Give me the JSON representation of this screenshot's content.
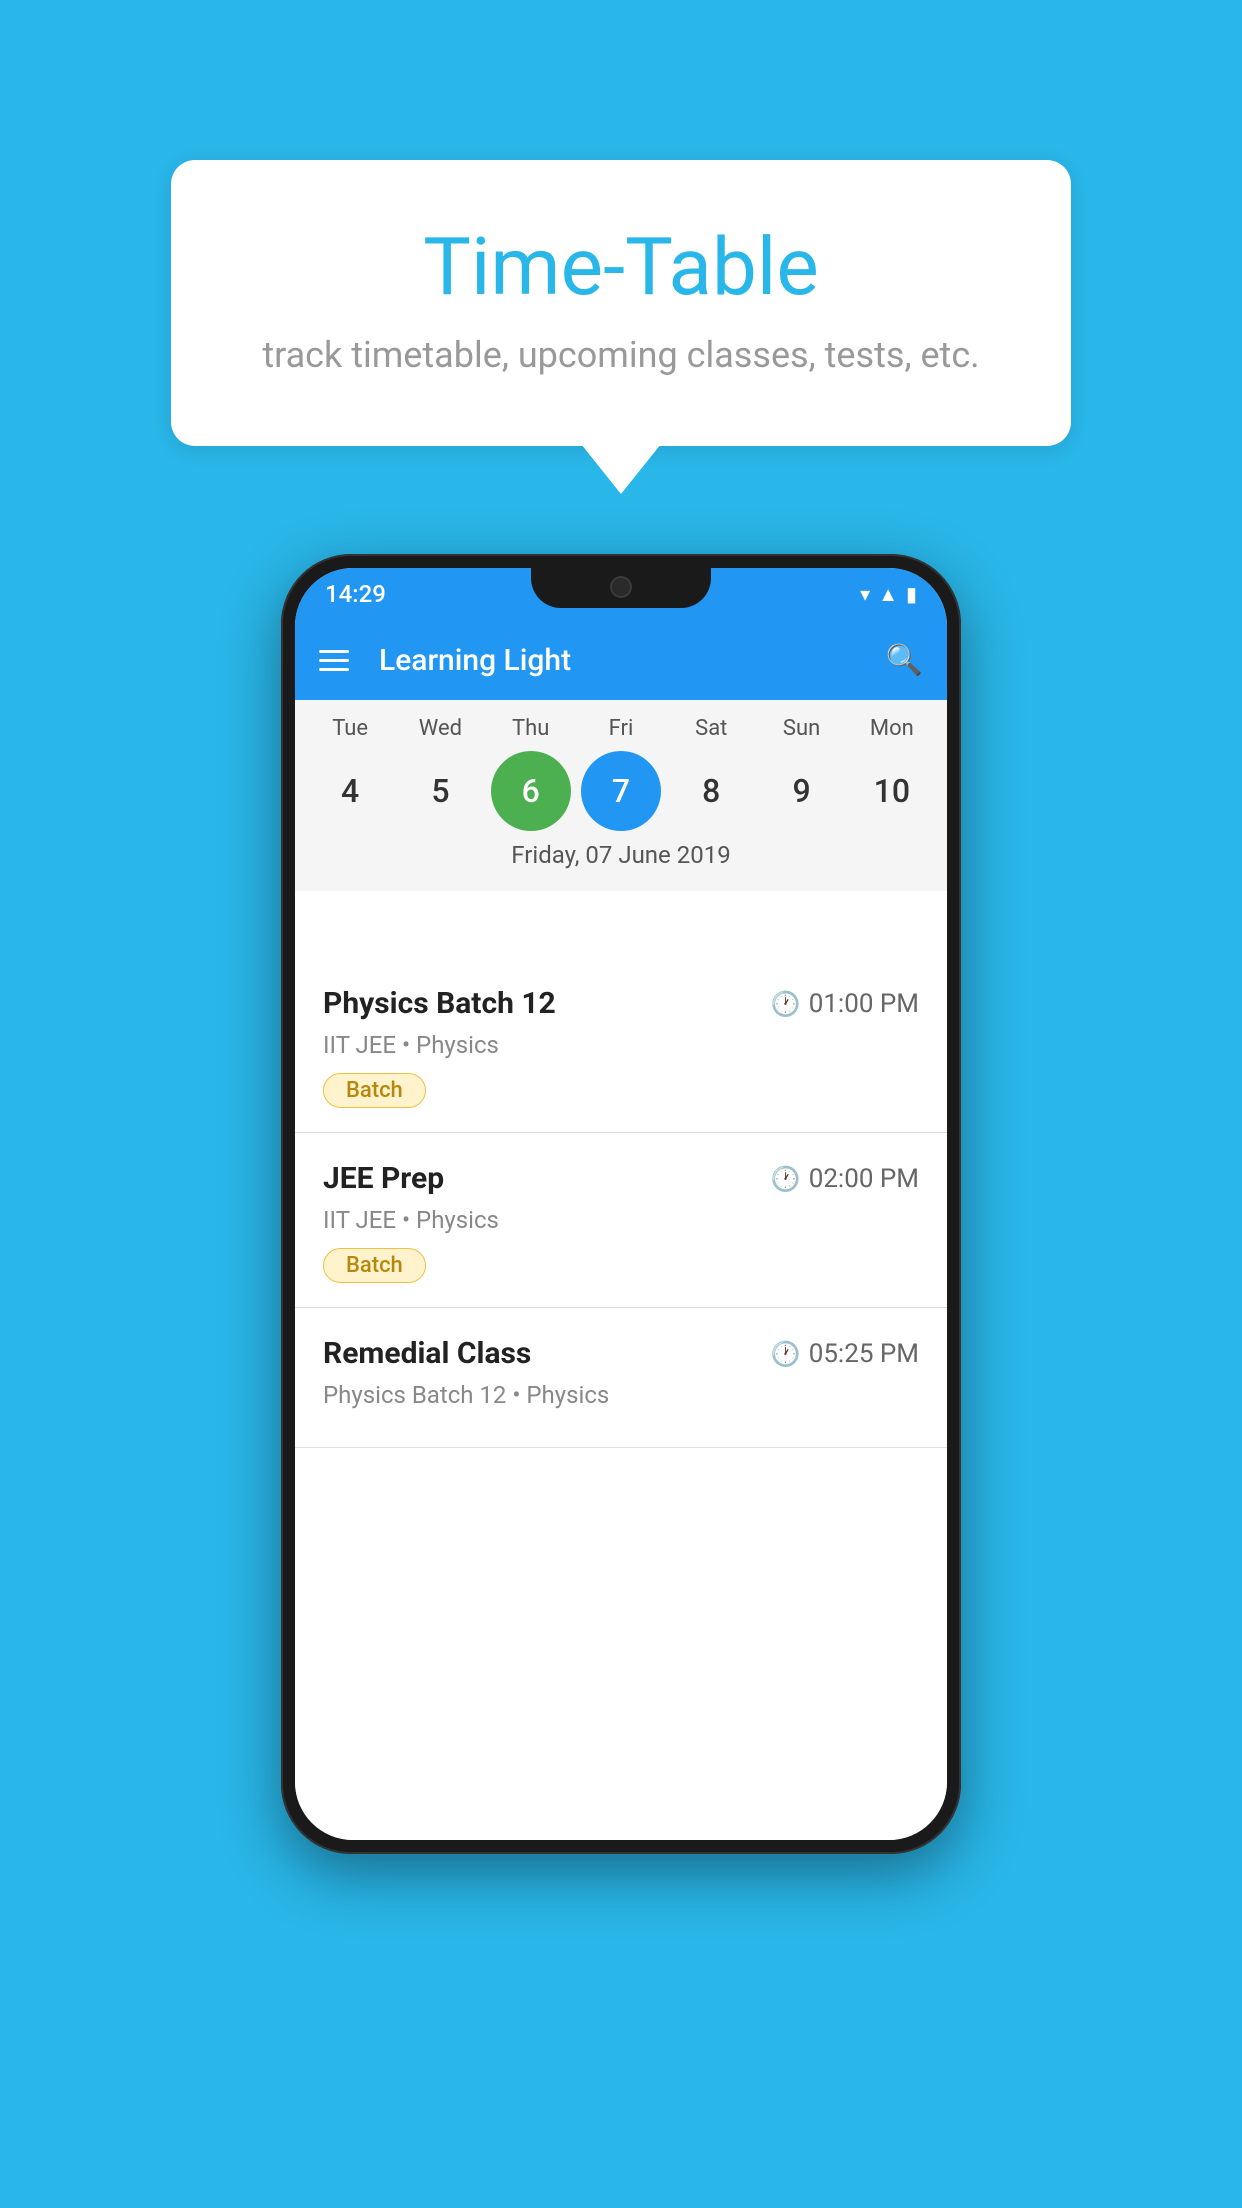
{
  "background_color": "#29b6e8",
  "bubble": {
    "title": "Time-Table",
    "subtitle": "track timetable, upcoming classes, tests, etc."
  },
  "app": {
    "time": "14:29",
    "title": "Learning Light"
  },
  "calendar": {
    "days": [
      "Tue",
      "Wed",
      "Thu",
      "Fri",
      "Sat",
      "Sun",
      "Mon"
    ],
    "dates": [
      "4",
      "5",
      "6",
      "7",
      "8",
      "9",
      "10"
    ],
    "today_index": 2,
    "selected_index": 3,
    "selected_label": "Friday, 07 June 2019"
  },
  "events": [
    {
      "title": "Physics Batch 12",
      "time": "01:00 PM",
      "subtitle": "IIT JEE • Physics",
      "tag": "Batch"
    },
    {
      "title": "JEE Prep",
      "time": "02:00 PM",
      "subtitle": "IIT JEE • Physics",
      "tag": "Batch"
    },
    {
      "title": "Remedial Class",
      "time": "05:25 PM",
      "subtitle": "Physics Batch 12 • Physics",
      "tag": ""
    }
  ]
}
